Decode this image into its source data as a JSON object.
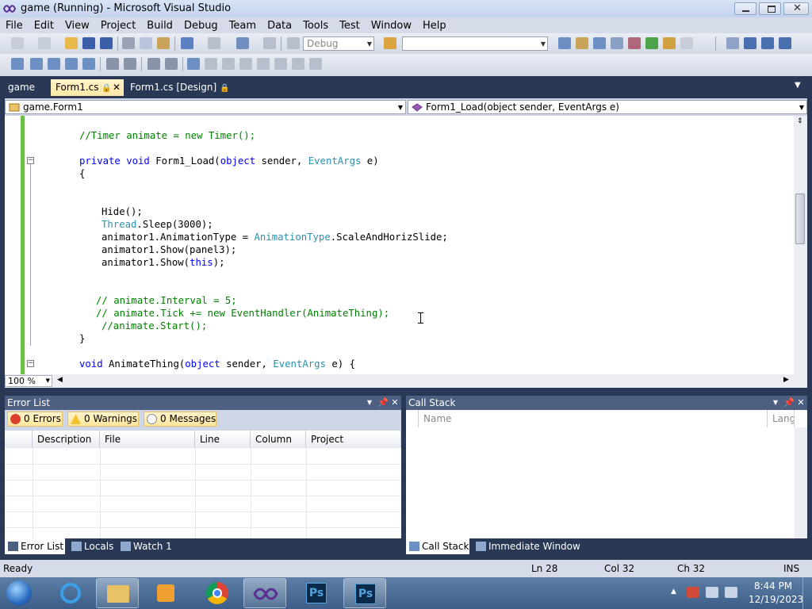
{
  "window": {
    "title": "game (Running) - Microsoft Visual Studio"
  },
  "menu": [
    "File",
    "Edit",
    "View",
    "Project",
    "Build",
    "Debug",
    "Team",
    "Data",
    "Tools",
    "Test",
    "Window",
    "Help"
  ],
  "toolbar": {
    "config_combo": "Debug",
    "find_combo": ""
  },
  "tabs": [
    {
      "label": "game",
      "active": false
    },
    {
      "label": "Form1.cs",
      "active": true
    },
    {
      "label": "Form1.cs [Design]",
      "active": false
    }
  ],
  "nav": {
    "class_combo": "game.Form1",
    "member_combo": "Form1_Load(object sender, EventArgs e)"
  },
  "code": {
    "l1": "//Timer animate = new Timer();",
    "l2a": "private void",
    "l2b": " Form1_Load(",
    "l2c": "object",
    "l2d": " sender, ",
    "l2e": "EventArgs",
    "l2f": " e)",
    "l3": "{",
    "l4": "Hide();",
    "l5a": "Thread",
    "l5b": ".Sleep(3000);",
    "l6a": "animator1.AnimationType = ",
    "l6b": "AnimationType",
    "l6c": ".ScaleAndHorizSlide;",
    "l7": "animator1.Show(panel3);",
    "l8a": "animator1.Show(",
    "l8b": "this",
    "l8c": ");",
    "l9": "// animate.Interval = 5;",
    "l10": "// animate.Tick += new EventHandler(AnimateThing);",
    "l11": "//animate.Start();",
    "l12": "}",
    "l13a": "void",
    "l13b": " AnimateThing(",
    "l13c": "object",
    "l13d": " sender, ",
    "l13e": "EventArgs",
    "l13f": " e) {"
  },
  "zoom": "100 %",
  "error_list": {
    "title": "Error List",
    "errors": "0 Errors",
    "warnings": "0 Warnings",
    "messages": "0 Messages",
    "columns": [
      "Description",
      "File",
      "Line",
      "Column",
      "Project"
    ]
  },
  "call_stack": {
    "title": "Call Stack",
    "columns": [
      "Name",
      "Lang"
    ]
  },
  "bottom_tabs_left": [
    "Error List",
    "Locals",
    "Watch 1"
  ],
  "bottom_tabs_right": [
    "Call Stack",
    "Immediate Window"
  ],
  "status": {
    "text": "Ready",
    "ln": "Ln 28",
    "col": "Col 32",
    "ch": "Ch 32",
    "mode": "INS"
  },
  "clock": {
    "time": "8:44 PM",
    "date": "12/19/2023"
  },
  "colors": {
    "keyword": "#0000ff",
    "type": "#2b91af",
    "comment": "#008000",
    "accent": "#293955"
  }
}
